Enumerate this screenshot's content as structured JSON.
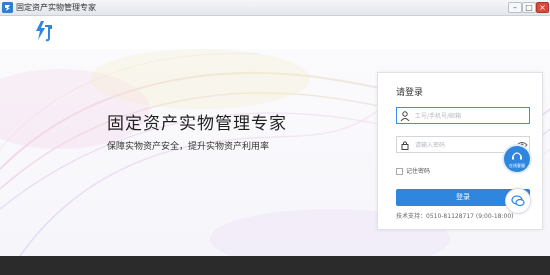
{
  "window": {
    "title": "固定资产实物管理专家",
    "min_symbol": "–",
    "max_symbol": "□",
    "close_symbol": "×"
  },
  "hero": {
    "slogan": "固定资产实物管理专家",
    "sub_slogan": "保障实物资产安全，提升实物资产利用率"
  },
  "login": {
    "title": "请登录",
    "username_placeholder": "工号/手机号/邮箱",
    "password_placeholder": "请输入密码",
    "remember_label": "记住密码",
    "submit_label": "登录",
    "support_text": "技术支持：0510-81128717 (9:00-18:00)"
  },
  "float": {
    "service_label": "在线客服"
  },
  "colors": {
    "accent": "#2f86df",
    "footer": "#2b2b2b"
  },
  "icons": [
    "app-icon",
    "brand-logo",
    "user-icon",
    "lock-icon",
    "eye-icon",
    "headset-icon",
    "chat-icon"
  ]
}
